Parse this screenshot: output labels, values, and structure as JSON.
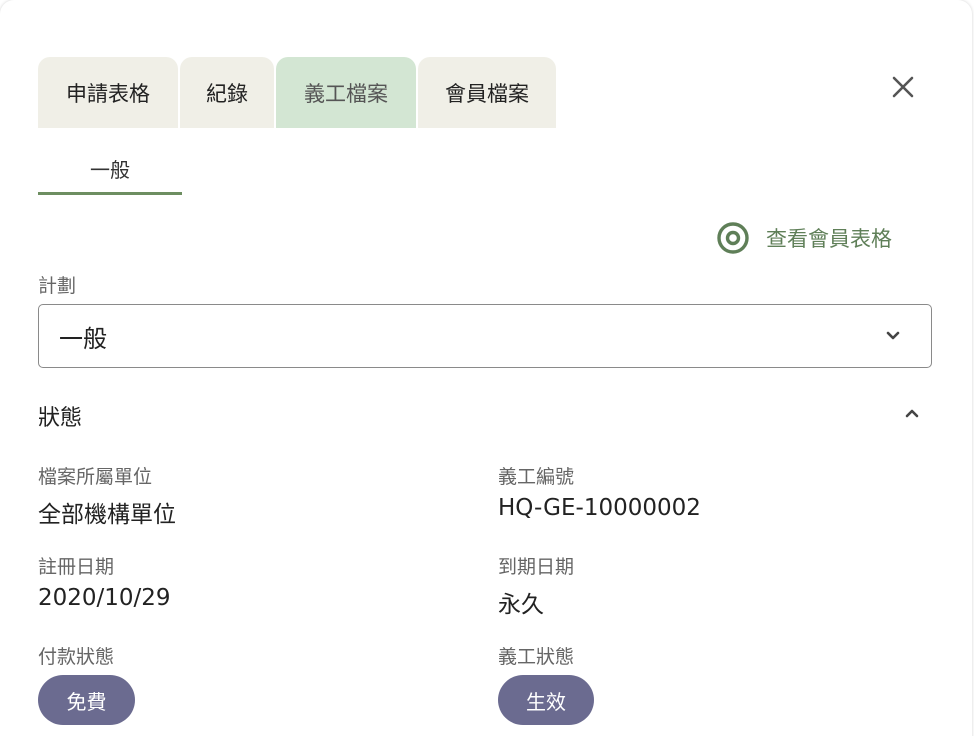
{
  "tabs": [
    {
      "label": "申請表格",
      "active": false
    },
    {
      "label": "紀錄",
      "active": false
    },
    {
      "label": "義工檔案",
      "active": true
    },
    {
      "label": "會員檔案",
      "active": false
    }
  ],
  "subtab": {
    "label": "一般"
  },
  "view_link": {
    "label": "查看會員表格",
    "icon": "eye-icon"
  },
  "plan": {
    "label": "計劃",
    "value": "一般"
  },
  "status_section": {
    "title": "狀態",
    "profile_unit_label": "檔案所屬單位",
    "profile_unit_value": "全部機構單位",
    "volunteer_no_label": "義工編號",
    "volunteer_no_value": "HQ-GE-10000002",
    "register_date_label": "註冊日期",
    "register_date_value": "2020/10/29",
    "expiry_date_label": "到期日期",
    "expiry_date_value": "永久",
    "payment_status_label": "付款狀態",
    "payment_status_value": "免費",
    "volunteer_status_label": "義工狀態",
    "volunteer_status_value": "生效"
  },
  "colors": {
    "active_tab": "#d3e6d3",
    "inactive_tab": "#f0efe7",
    "accent_green": "#5f7f58",
    "badge": "#6b6b90"
  }
}
